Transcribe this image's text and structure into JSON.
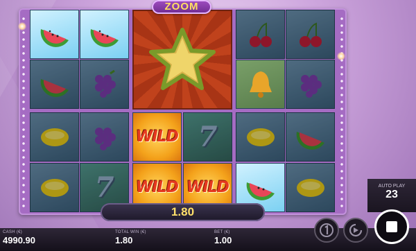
{
  "game": {
    "feature_badge": "ZOOM",
    "win_amount": "1.80"
  },
  "autoplay": {
    "label": "AUTO PLAY",
    "value": "23"
  },
  "stats": {
    "cash_label": "CASH (€)",
    "cash_value": "4990.90",
    "total_win_label": "TOTAL WIN (€)",
    "total_win_value": "1.80",
    "bet_label": "BET (€)",
    "bet_value": "1.00"
  },
  "reels": {
    "wild_label": "WILD",
    "seven_label": "7",
    "symbols": [
      "watermelon",
      "watermelon",
      "cherries",
      "cherries",
      "watermelon",
      "grapes",
      "bell",
      "grapes",
      "lemon",
      "grapes",
      "wild",
      "seven",
      "lemon",
      "watermelon",
      "lemon",
      "seven",
      "wild",
      "wild",
      "watermelon",
      "lemon",
      "star"
    ]
  },
  "colors": {
    "accent": "#ffe06a",
    "wild_red": "#e6391f",
    "frame": "#a56cc3"
  }
}
